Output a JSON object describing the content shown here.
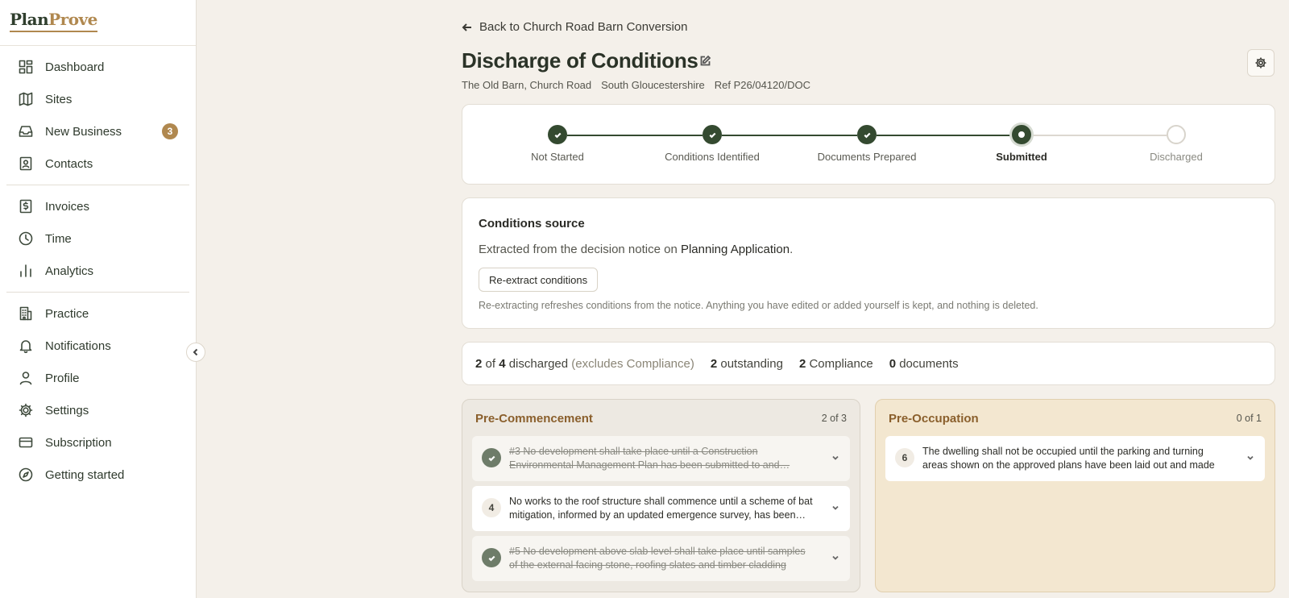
{
  "logo": {
    "part1": "Plan",
    "part2": "Prove"
  },
  "sidebar": {
    "group1": [
      {
        "label": "Dashboard",
        "icon": "dashboard-icon"
      },
      {
        "label": "Sites",
        "icon": "map-icon"
      },
      {
        "label": "New Business",
        "icon": "inbox-icon",
        "badge": "3"
      },
      {
        "label": "Contacts",
        "icon": "contacts-icon"
      }
    ],
    "group2": [
      {
        "label": "Invoices",
        "icon": "invoice-icon"
      },
      {
        "label": "Time",
        "icon": "clock-icon"
      },
      {
        "label": "Analytics",
        "icon": "bar-chart-icon"
      }
    ],
    "group3": [
      {
        "label": "Practice",
        "icon": "building-icon"
      },
      {
        "label": "Notifications",
        "icon": "bell-icon"
      },
      {
        "label": "Profile",
        "icon": "user-icon"
      },
      {
        "label": "Settings",
        "icon": "gear-icon"
      },
      {
        "label": "Subscription",
        "icon": "credit-card-icon"
      },
      {
        "label": "Getting started",
        "icon": "compass-icon"
      }
    ]
  },
  "header": {
    "back_label": "Back to Church Road Barn Conversion",
    "title": "Discharge of Conditions",
    "address": "The Old Barn, Church Road",
    "council": "South Gloucestershire",
    "ref": "Ref P26/04120/DOC"
  },
  "stepper": {
    "steps": [
      {
        "label": "Not Started",
        "state": "done"
      },
      {
        "label": "Conditions Identified",
        "state": "done"
      },
      {
        "label": "Documents Prepared",
        "state": "done"
      },
      {
        "label": "Submitted",
        "state": "current"
      },
      {
        "label": "Discharged",
        "state": "todo"
      }
    ],
    "done_color": "#344a30",
    "todo_color": "#dcd8d0"
  },
  "source": {
    "heading": "Conditions source",
    "desc_prefix": "Extracted from the decision notice on",
    "desc_link": "Planning Application",
    "desc_suffix": ".",
    "button": "Re-extract conditions",
    "note": "Re-extracting refreshes conditions from the notice. Anything you have edited or added yourself is kept, and nothing is deleted."
  },
  "summary": {
    "discharged_n": "2",
    "of": "of",
    "discharged_total": "4",
    "discharged_label": "discharged",
    "excludes": "(excludes Compliance)",
    "outstanding_n": "2",
    "outstanding_label": "outstanding",
    "compliance_n": "2",
    "compliance_label": "Compliance",
    "documents_n": "0",
    "documents_label": "documents"
  },
  "columns": {
    "pre_commencement": {
      "title": "Pre-Commencement",
      "count": "2 of 3",
      "items": [
        {
          "num": "#3",
          "text": "No development shall take place until a Construction Environmental Management Plan has been submitted to and…",
          "done": true
        },
        {
          "num": "4",
          "text": "No works to the roof structure shall commence until a scheme of bat mitigation, informed by an updated emergence survey, has been…",
          "done": false
        },
        {
          "num": "#5",
          "text": "No development above slab level shall take place until samples of the external facing stone, roofing slates and timber cladding have…",
          "done": true
        }
      ]
    },
    "pre_occupation": {
      "title": "Pre-Occupation",
      "count": "0 of 1",
      "items": [
        {
          "num": "6",
          "text": "The dwelling shall not be occupied until the parking and turning areas shown on the approved plans have been laid out and made available…",
          "done": false
        }
      ]
    }
  }
}
